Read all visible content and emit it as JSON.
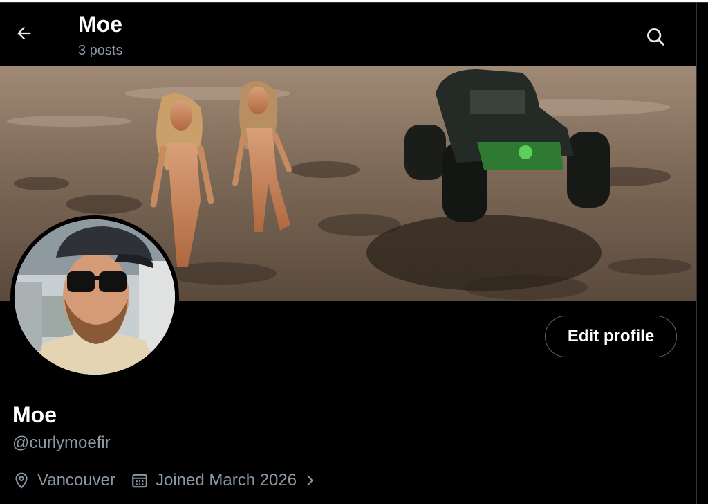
{
  "header": {
    "title": "Moe",
    "posts_count": "3 posts",
    "back_icon": "arrow-left-icon",
    "search_icon": "search-icon"
  },
  "profile": {
    "display_name": "Moe",
    "handle": "@curlymoefir",
    "location": "Vancouver",
    "joined": "Joined March 2026",
    "edit_button_label": "Edit profile"
  },
  "colors": {
    "background": "#000000",
    "primary_text": "#e7e9ea",
    "secondary_text": "#8b98a5",
    "border": "#536471"
  }
}
